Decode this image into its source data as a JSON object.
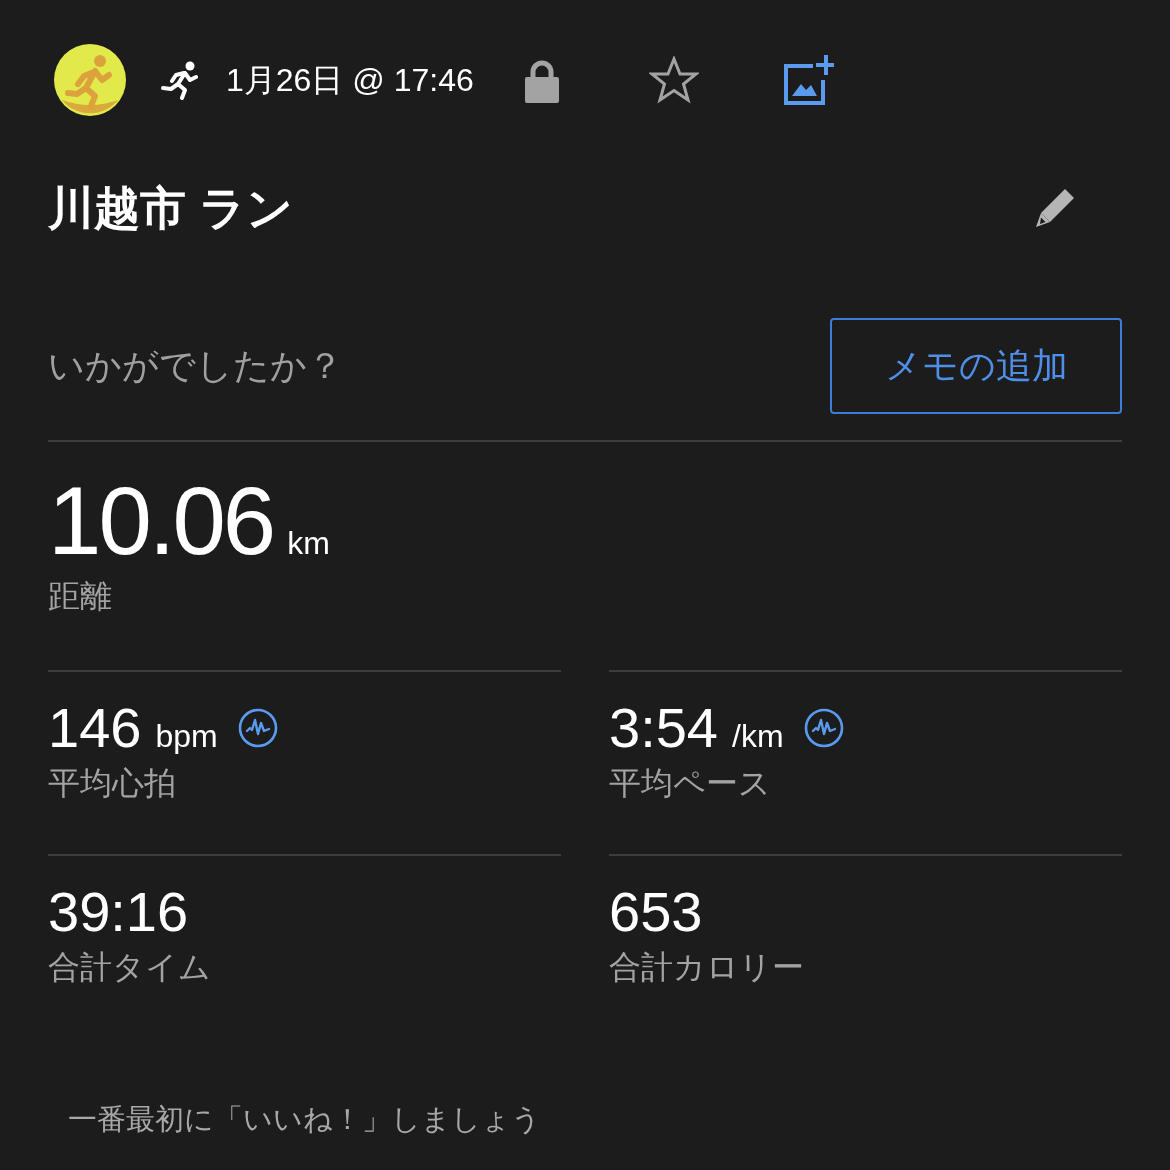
{
  "header": {
    "date": "1月26日 @ 17:46",
    "private": true,
    "favorite": false
  },
  "title": "川越市 ラン",
  "feedback": {
    "prompt": "いかがでしたか？",
    "button": "メモの追加"
  },
  "distance": {
    "value": "10.06",
    "unit": "km",
    "label": "距離"
  },
  "stats": [
    {
      "kind": "chart",
      "value": "146",
      "unit": "bpm",
      "label": "平均心拍"
    },
    {
      "kind": "chart",
      "value": "3:54",
      "unit": "/km",
      "label": "平均ペース"
    },
    {
      "kind": "plain",
      "value": "39:16",
      "label": "合計タイム"
    },
    {
      "kind": "plain",
      "value": "653",
      "label": "合計カロリー"
    }
  ],
  "like_prompt": "一番最初に「いいね！」しましょう"
}
